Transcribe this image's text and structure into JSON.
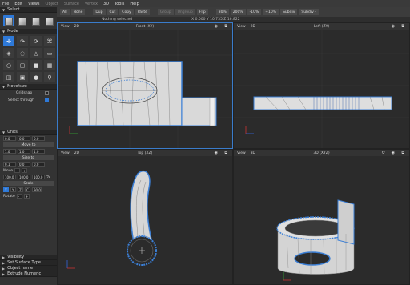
{
  "menu": [
    "File",
    "Edit",
    "Views",
    "Object",
    "Surface",
    "Vertex",
    "3D",
    "Tools",
    "Help"
  ],
  "toolbar": {
    "buttons": [
      "All",
      "None",
      "Dup",
      "Cut",
      "Copy",
      "Paste",
      "Group",
      "Ungroup",
      "Flip",
      "30%",
      "200%",
      "-10%",
      "+10%",
      "Subdiv",
      "Subdiv -"
    ],
    "disabled": [
      "Group",
      "Ungroup"
    ]
  },
  "status": {
    "selection": "Nothing selected",
    "coords": "X 0.000 Y 10.735 Z 16.822"
  },
  "sidebar": {
    "select_title": "Select",
    "mode_title": "Mode",
    "move_title": "Move/size",
    "gridsnap": "Gridsnap",
    "select_through": "Select through",
    "units_title": "Units",
    "move_vals": [
      "0.0",
      "0.0",
      "0.0"
    ],
    "move_to": "Move to",
    "size_vals": [
      "1.0",
      "1.0",
      "1.0"
    ],
    "size_to": "Size to",
    "move2_vals": [
      "0.1",
      "0.0",
      "0.0"
    ],
    "move_label": "Move",
    "scale_vals": [
      "100.0",
      "100.0",
      "100.0"
    ],
    "scale_unit": "%",
    "scale_label": "Scale",
    "axes": [
      "X",
      "Y",
      "Z",
      "C"
    ],
    "angle": "90.0",
    "rotate_label": "Rotate",
    "panels": [
      "Visibility",
      "Set Surface Type",
      "Object name",
      "Extrude Numeric"
    ]
  },
  "viewports": [
    {
      "view": "View",
      "mode": "2D",
      "name": "Front (XY)"
    },
    {
      "view": "View",
      "mode": "2D",
      "name": "Left (ZY)"
    },
    {
      "view": "View",
      "mode": "2D",
      "name": "Top (XZ)"
    },
    {
      "view": "View",
      "mode": "3D",
      "name": "3D (XYZ)"
    }
  ],
  "colors": {
    "accent": "#2e79d8",
    "vertex": "#3b7fd6",
    "axis_x": "#cc3333",
    "axis_y": "#33aa33",
    "axis_z": "#3366dd"
  }
}
